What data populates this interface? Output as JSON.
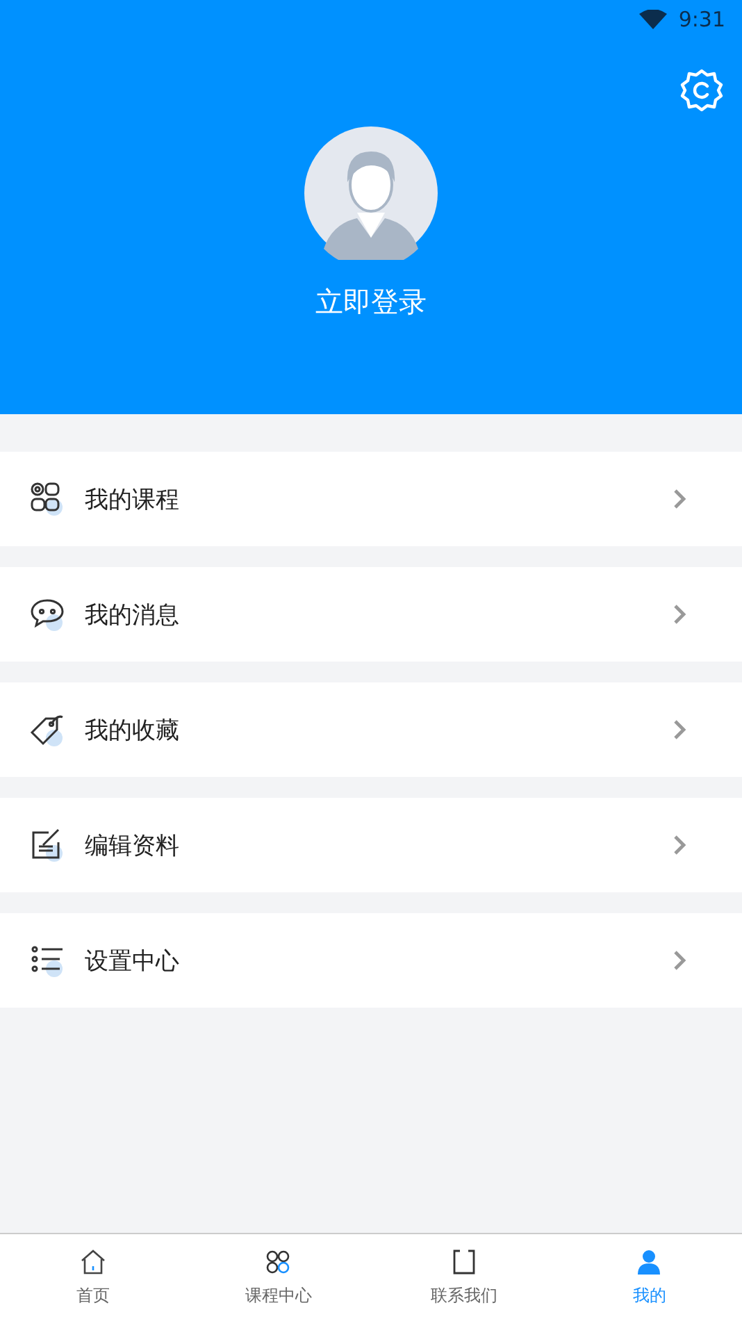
{
  "status_bar": {
    "time": "9:31"
  },
  "header": {
    "login_label": "立即登录"
  },
  "menu": [
    {
      "kind": "courses",
      "label": "我的课程"
    },
    {
      "kind": "messages",
      "label": "我的消息"
    },
    {
      "kind": "favorites",
      "label": "我的收藏"
    },
    {
      "kind": "edit",
      "label": "编辑资料"
    },
    {
      "kind": "settings",
      "label": "设置中心"
    }
  ],
  "tabs": [
    {
      "kind": "home",
      "label": "首页",
      "selected": false
    },
    {
      "kind": "courses",
      "label": "课程中心",
      "selected": false
    },
    {
      "kind": "contact",
      "label": "联系我们",
      "selected": false
    },
    {
      "kind": "profile",
      "label": "我的",
      "selected": true
    }
  ]
}
